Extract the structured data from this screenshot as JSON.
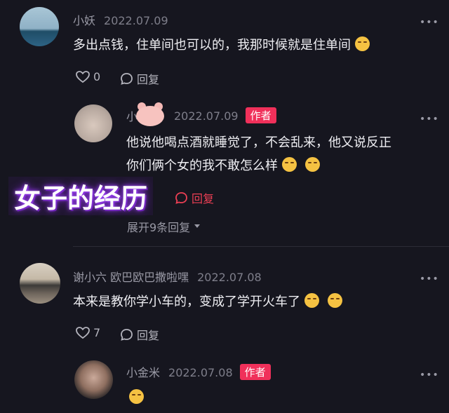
{
  "more_glyph": "•••",
  "overlay_title": "女子的经历",
  "comments": [
    {
      "username": "小妖",
      "date": "2022.07.09",
      "text": "多出点钱，住单间也可以的，我那时候就是住单间",
      "likes": "0",
      "reply_label": "回复"
    },
    {
      "username": "小",
      "date": "2022.07.09",
      "badge": "作者",
      "text_line1": "他说他喝点酒就睡觉了，不会乱来，他又说反正",
      "text_line2": "你们俩个女的我不敢怎么样",
      "reply_label": "回复",
      "expand_label": "展开9条回复"
    },
    {
      "username": "谢小六 欧巴欧巴撒啦嘿",
      "date": "2022.07.08",
      "text": "本来是教你学小车的，变成了学开火车了",
      "likes": "7",
      "reply_label": "回复"
    },
    {
      "username": "小金米",
      "date": "2022.07.08",
      "badge": "作者"
    }
  ]
}
